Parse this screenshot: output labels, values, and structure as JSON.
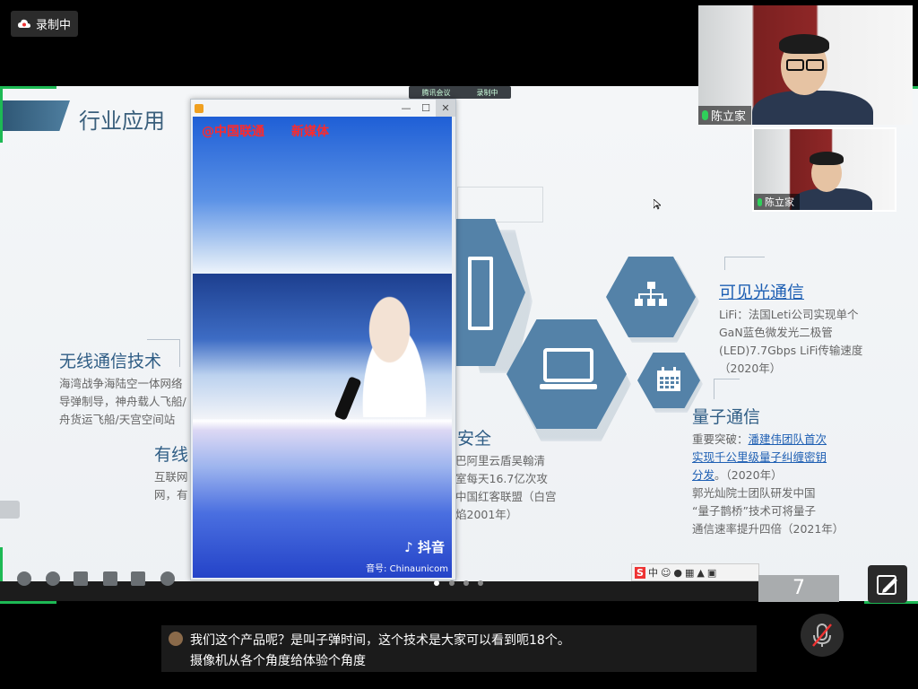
{
  "recording_badge": {
    "label": "录制中"
  },
  "meeting_badge": {
    "app": "腾讯会议",
    "status": "录制中"
  },
  "slide": {
    "title": "行业应用",
    "page_number": "7",
    "wireless": {
      "title": "无线通信技术",
      "lines": [
        "海湾战争海陆空一体网络",
        "导弹制导，神舟载人飞船/",
        "舟货运飞船/天宫空间站"
      ]
    },
    "wired": {
      "title": "有线",
      "lines": [
        "互联网",
        "网，有"
      ]
    },
    "security": {
      "title": "安全",
      "lines": [
        "巴阿里云盾吴翰清",
        "室每天16.7亿次攻",
        "中国红客联盟（白宫",
        "焰2001年）"
      ]
    },
    "visible_light": {
      "title": "可见光通信",
      "lines": [
        "LiFi：法国Leti公司实现单个",
        "GaN蓝色微发光二极管",
        "(LED)7.7Gbps LiFi传输速度",
        "（2020年）"
      ]
    },
    "quantum": {
      "title": "量子通信",
      "line1_prefix": "重要突破：",
      "line1_link": "潘建伟团队首次",
      "line2_link": "实现千公里级量子纠缠密钥",
      "line3_link": "分发",
      "line3_suffix": "。（2020年）",
      "lines_after": [
        "郭光灿院士团队研发中国",
        "“量子鹊桥”技术可将量子",
        "通信速率提升四倍（2021年）"
      ]
    }
  },
  "video_popup": {
    "brand": "@中国联通",
    "brand2": "新媒体",
    "platform": "抖音",
    "account": "音号: Chinaunicom"
  },
  "participants": [
    {
      "name": "陈立家"
    },
    {
      "name": "陈立家"
    }
  ],
  "ime": {
    "label": "中"
  },
  "subtitles": {
    "line1": "我们这个产品呢？是叫子弹时间，这个技术是大家可以看到呃18个。",
    "line2": "摄像机从各个角度给体验个角度"
  },
  "colors": {
    "accent_green": "#1db954",
    "slide_blue": "#5482a8",
    "title_blue": "#2f5d85"
  }
}
